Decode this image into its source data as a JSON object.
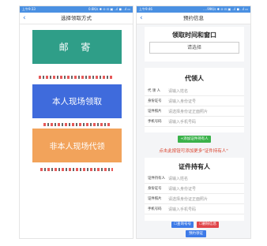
{
  "left": {
    "status": {
      "time": "上午9:33",
      "right": "0.6K/s ✱ ⊙ ⊡ ▣ ..ıl ◼ ..ıl ▭"
    },
    "title": "选择领取方式",
    "back": "‹",
    "options": {
      "mail": "邮 寄",
      "self": "本人现场领取",
      "agent": "非本人现场代领"
    }
  },
  "right": {
    "status": {
      "time": "上午9:46",
      "right": "....99K/s ✱ ⊙ ⊡ ▣ ..ıl ◼ ..ıl ▭"
    },
    "title": "预约信息",
    "back": "‹",
    "time_window": {
      "title": "领取时间和窗口",
      "select": "请选择"
    },
    "agent": {
      "title": "代领人",
      "rows": [
        {
          "label": "代 领 人",
          "placeholder": "请输入姓名"
        },
        {
          "label": "身份证号",
          "placeholder": "请输入身份证号"
        },
        {
          "label": "证件照片",
          "placeholder": "请选择身份证正面照片"
        },
        {
          "label": "手机号码",
          "placeholder": "请输入手机号码"
        }
      ],
      "add_button": "+添加证件持有人"
    },
    "note": "点击此按钮可添加更多\"证件持有人\"",
    "holder": {
      "title": "证件持有人",
      "rows": [
        {
          "label": "证件持有人",
          "placeholder": "请输入姓名"
        },
        {
          "label": "身份证号",
          "placeholder": "请输入身份证号"
        },
        {
          "label": "证件照片",
          "placeholder": "请选择身份证正面照片"
        },
        {
          "label": "手机号码",
          "placeholder": "请输入手机号码"
        }
      ],
      "query_button": "☐查询号号",
      "delete_button": "☐删除信息"
    },
    "submit": "预约领证"
  }
}
